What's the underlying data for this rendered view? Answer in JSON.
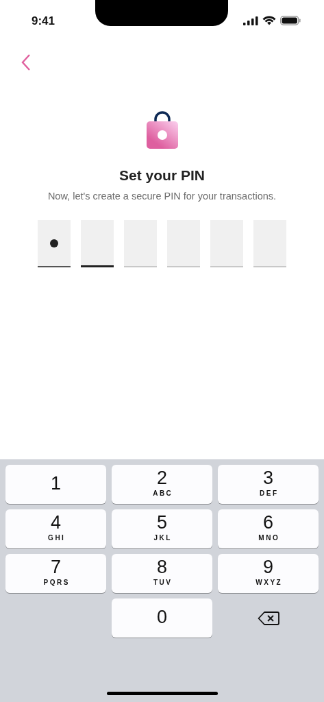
{
  "status_bar": {
    "time": "9:41"
  },
  "header": {
    "title": "Set your PIN",
    "subtitle": "Now, let's create a secure PIN for your transactions."
  },
  "pin_boxes": [
    {
      "filled": true,
      "selected": false
    },
    {
      "filled": false,
      "selected": true
    },
    {
      "filled": false,
      "selected": false
    },
    {
      "filled": false,
      "selected": false
    },
    {
      "filled": false,
      "selected": false
    },
    {
      "filled": false,
      "selected": false
    }
  ],
  "keypad": [
    {
      "kind": "digit",
      "digit": "1"
    },
    {
      "kind": "digit",
      "digit": "2",
      "letters": "ABC"
    },
    {
      "kind": "digit",
      "digit": "3",
      "letters": "DEF"
    },
    {
      "kind": "digit",
      "digit": "4",
      "letters": "GHI"
    },
    {
      "kind": "digit",
      "digit": "5",
      "letters": "JKL"
    },
    {
      "kind": "digit",
      "digit": "6",
      "letters": "MNO"
    },
    {
      "kind": "digit",
      "digit": "7",
      "letters": "PQRS"
    },
    {
      "kind": "digit",
      "digit": "8",
      "letters": "TUV"
    },
    {
      "kind": "digit",
      "digit": "9",
      "letters": "WXYZ"
    },
    {
      "kind": "blank"
    },
    {
      "kind": "digit",
      "digit": "0"
    },
    {
      "kind": "delete"
    }
  ]
}
